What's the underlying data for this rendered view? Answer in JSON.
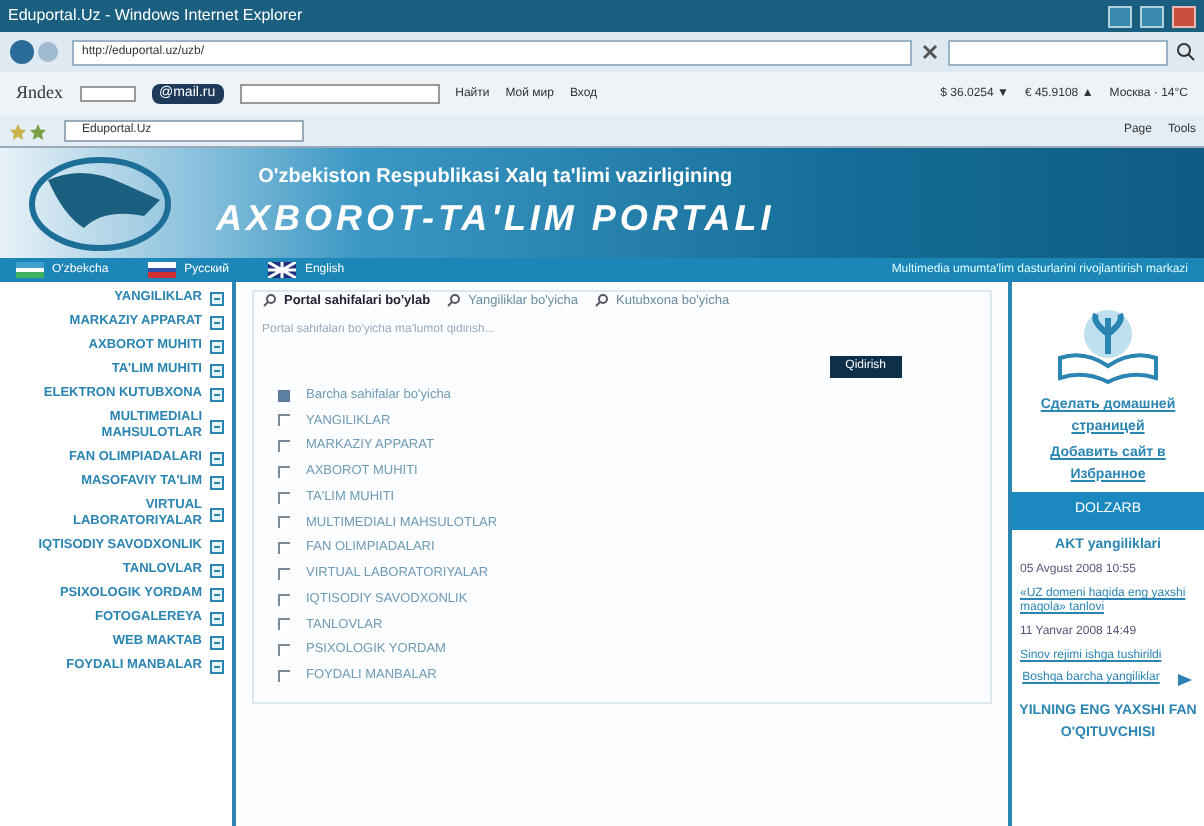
{
  "window": {
    "title": "Eduportal.Uz - Windows Internet Explorer"
  },
  "address_bar": {
    "url": "http://eduportal.uz/uzb/"
  },
  "toolbar": {
    "yandex": "Яndex",
    "mail": "@mail.ru",
    "find": "Найти",
    "my_world": "Мой мир",
    "login": "Вход",
    "usd": "$ 36.0254 ▼",
    "eur": "€ 45.9108 ▲",
    "weather": "Москва · 14°C"
  },
  "tab_row": {
    "tab": "Eduportal.Uz",
    "page": "Page",
    "tools": "Tools"
  },
  "banner": {
    "subtitle": "O'zbekiston Respublikasi Xalq ta'limi vazirligining",
    "title": "AXBOROT-TA'LIM PORTALI"
  },
  "languages": [
    {
      "label": "O'zbekcha",
      "kind": "uz"
    },
    {
      "label": "Русский",
      "kind": "ru"
    },
    {
      "label": "English",
      "kind": "en"
    }
  ],
  "center_name": "Multimedia umumta'lim dasturlarini rivojlantirish markazi",
  "sidebar": {
    "items": [
      "YANGILIKLAR",
      "MARKAZIY APPARAT",
      "AXBOROT MUHITI",
      "TA'LIM MUHITI",
      "ELEKTRON KUTUBXONA",
      "MULTIMEDIALI MAHSULOTLAR",
      "FAN OLIMPIADALARI",
      "MASOFAVIY TA'LIM",
      "VIRTUAL LABORATORIYALAR",
      "IQTISODIY SAVODXONLIK",
      "TANLOVLAR",
      "PSIXOLOGIK YORDAM",
      "FOTOGALEREYA",
      "WEB MAKTAB",
      "FOYDALI MANBALAR"
    ]
  },
  "search": {
    "tabs": [
      {
        "label": "Portal sahifalari bo'ylab",
        "selected": true
      },
      {
        "label": "Yangiliklar bo'yicha",
        "selected": false
      },
      {
        "label": "Kutubxona bo'yicha",
        "selected": false
      }
    ],
    "placeholder": "Portal sahifalari bo'yicha ma'lumot qidirish...",
    "button": "Qidirish",
    "options": [
      {
        "label": "Barcha sahifalar bo'yicha",
        "checked": true
      },
      {
        "label": "YANGILIKLAR",
        "checked": false
      },
      {
        "label": "MARKAZIY APPARAT",
        "checked": false
      },
      {
        "label": "AXBOROT MUHITI",
        "checked": false
      },
      {
        "label": "TA'LIM MUHITI",
        "checked": false
      },
      {
        "label": "MULTIMEDIALI MAHSULOTLAR",
        "checked": false
      },
      {
        "label": "FAN OLIMPIADALARI",
        "checked": false
      },
      {
        "label": "VIRTUAL LABORATORIYALAR",
        "checked": false
      },
      {
        "label": "IQTISODIY SAVODXONLIK",
        "checked": false
      },
      {
        "label": "TANLOVLAR",
        "checked": false
      },
      {
        "label": "PSIXOLOGIK YORDAM",
        "checked": false
      },
      {
        "label": "FOYDALI MANBALAR",
        "checked": false
      }
    ]
  },
  "right_column": {
    "links": [
      "Сделать домашней страницей",
      "Добавить сайт в Избранное"
    ],
    "header": "DOLZARB",
    "news_title": "AKT yangiliklari",
    "news": [
      {
        "date": "05 Avgust 2008 10:55",
        "headline": "«UZ domeni haqida eng yaxshi maqola» tanlovi"
      },
      {
        "date": "11 Yanvar 2008 14:49",
        "headline": "Sinov rejimi ishga tushirildi"
      }
    ],
    "more": "Boshqa barcha yangiliklar",
    "promo": "YILNING ENG YAXSHI FAN O'QITUVCHISI"
  }
}
